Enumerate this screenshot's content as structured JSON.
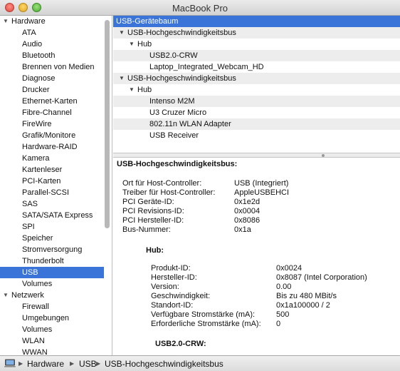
{
  "window": {
    "title": "MacBook Pro"
  },
  "sidebar": {
    "groups": [
      {
        "label": "Hardware",
        "items": [
          "ATA",
          "Audio",
          "Bluetooth",
          "Brennen von Medien",
          "Diagnose",
          "Drucker",
          "Ethernet-Karten",
          "Fibre-Channel",
          "FireWire",
          "Grafik/Monitore",
          "Hardware-RAID",
          "Kamera",
          "Kartenleser",
          "PCI-Karten",
          "Parallel-SCSI",
          "SAS",
          "SATA/SATA Express",
          "SPI",
          "Speicher",
          "Stromversorgung",
          "Thunderbolt",
          "USB",
          "Volumes"
        ]
      },
      {
        "label": "Netzwerk",
        "items": [
          "Firewall",
          "Umgebungen",
          "Volumes",
          "WLAN",
          "WWAN"
        ]
      }
    ],
    "selected": "USB"
  },
  "tree": {
    "header": "USB-Gerätebaum",
    "rows": [
      {
        "label": "USB-Hochgeschwindigkeitsbus",
        "depth": 0,
        "expandable": true
      },
      {
        "label": "Hub",
        "depth": 1,
        "expandable": true
      },
      {
        "label": "USB2.0-CRW",
        "depth": 2,
        "expandable": false
      },
      {
        "label": "Laptop_Integrated_Webcam_HD",
        "depth": 2,
        "expandable": false
      },
      {
        "label": "USB-Hochgeschwindigkeitsbus",
        "depth": 0,
        "expandable": true
      },
      {
        "label": "Hub",
        "depth": 1,
        "expandable": true
      },
      {
        "label": "Intenso M2M",
        "depth": 2,
        "expandable": false
      },
      {
        "label": "U3 Cruzer Micro",
        "depth": 2,
        "expandable": false
      },
      {
        "label": "802.11n WLAN Adapter",
        "depth": 2,
        "expandable": false
      },
      {
        "label": "USB Receiver",
        "depth": 2,
        "expandable": false
      }
    ]
  },
  "detail": {
    "title": "USB-Hochgeschwindigkeitsbus:",
    "bus_props": [
      {
        "key": "Ort für Host-Controller:",
        "value": "USB (Integriert)"
      },
      {
        "key": "Treiber für Host-Controller:",
        "value": "AppleUSBEHCI"
      },
      {
        "key": "PCI Geräte-ID:",
        "value": "0x1e2d"
      },
      {
        "key": "PCI Revisions-ID:",
        "value": "0x0004"
      },
      {
        "key": "PCI Hersteller-ID:",
        "value": "0x8086"
      },
      {
        "key": "Bus-Nummer:",
        "value": "0x1a"
      }
    ],
    "hub_title": "Hub:",
    "hub_props": [
      {
        "key": "Produkt-ID:",
        "value": "0x0024"
      },
      {
        "key": "Hersteller-ID:",
        "value": "0x8087  (Intel Corporation)"
      },
      {
        "key": "Version:",
        "value": " 0.00"
      },
      {
        "key": "Geschwindigkeit:",
        "value": "Bis zu 480 MBit/s"
      },
      {
        "key": "Standort-ID:",
        "value": "0x1a100000 / 2"
      },
      {
        "key": "Verfügbare Stromstärke (mA):",
        "value": "500"
      },
      {
        "key": "Erforderliche Stromstärke (mA):",
        "value": "0"
      }
    ],
    "sub_title": "USB2.0-CRW:"
  },
  "pathbar": {
    "segments": [
      "Hardware",
      "USB",
      "USB-Hochgeschwindigkeitsbus"
    ]
  },
  "colors": {
    "selection": "#3a74d9",
    "alt_row": "#ededed"
  }
}
